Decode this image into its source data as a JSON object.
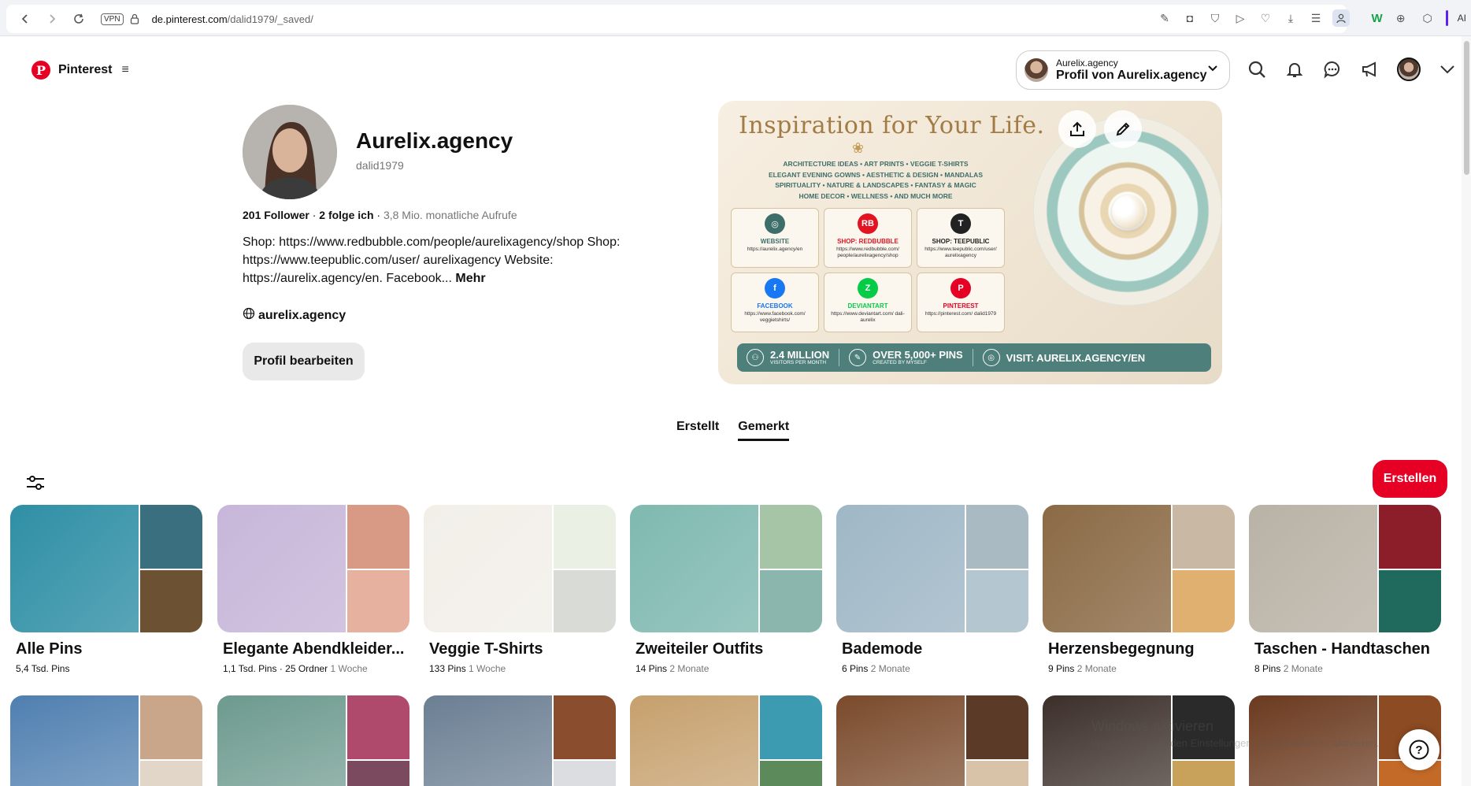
{
  "browser": {
    "url_host": "de.pinterest.com",
    "url_path": "/dalid1979/_saved/",
    "vpn_label": "VPN",
    "ext_w": "W",
    "ext_ai": "AI"
  },
  "header": {
    "logo_text": "Pinterest",
    "account_small": "Aurelix.agency",
    "account_big": "Profil von Aurelix.agency"
  },
  "profile": {
    "name": "Aurelix.agency",
    "handle": "dalid1979",
    "followers": "201 Follower",
    "following": "2 folge ich",
    "monthly_views": "3,8 Mio. monatliche Aufrufe",
    "bio": "Shop: https://www.redbubble.com/people/aurelixagency/shop Shop: https://www.teepublic.com/user/ aurelixagency Website: https://aurelix.agency/en. Facebook...",
    "bio_more": "Mehr",
    "website": "aurelix.agency",
    "edit_button": "Profil bearbeiten"
  },
  "banner": {
    "title": "Inspiration for Your Life.",
    "categories_line1": "ARCHITECTURE IDEAS  •  ART PRINTS  •  VEGGIE T-SHIRTS",
    "categories_line2": "ELEGANT EVENING GOWNS  •  AESTHETIC & DESIGN  •  MANDALAS",
    "categories_line3": "SPIRITUALITY  •  NATURE & LANDSCAPES  •  FANTASY & MAGIC",
    "categories_line4": "HOME DECOR  •  WELLNESS  •  AND MUCH MORE",
    "tiles": [
      {
        "label": "WEBSITE",
        "url": "https://aurelix.agency/en",
        "color": "#3e6e6a",
        "glyph": "◎"
      },
      {
        "label": "SHOP: REDBUBBLE",
        "url": "https://www.redbubble.com/ people/aurelixagency/shop",
        "color": "#e41321",
        "glyph": "RB"
      },
      {
        "label": "SHOP: TEEPUBLIC",
        "url": "https://www.teepublic.com/user/ aurelixagency",
        "color": "#222222",
        "glyph": "T"
      },
      {
        "label": "FACEBOOK",
        "url": "https://www.facebook.com/ veggietshirts/",
        "color": "#1877f2",
        "glyph": "f"
      },
      {
        "label": "DEVIANTART",
        "url": "https://www.deviantart.com/ dali-aurelix",
        "color": "#05cc47",
        "glyph": "Z"
      },
      {
        "label": "PINTEREST",
        "url": "https://pinterest.com/ dalid1979",
        "color": "#e60023",
        "glyph": "P"
      }
    ],
    "stat1_big": "2.4 MILLION",
    "stat1_small": "VISITORS PER MONTH",
    "stat2_big": "OVER 5,000+ PINS",
    "stat2_small": "CREATED BY MYSELF",
    "stat3_big": "VISIT: AURELIX.AGENCY/EN"
  },
  "tabs": {
    "created": "Erstellt",
    "saved": "Gemerkt"
  },
  "actions": {
    "create": "Erstellen"
  },
  "boards": [
    {
      "title": "Alle Pins",
      "pins": "5,4 Tsd. Pins",
      "extra": "",
      "time": "",
      "c1": "#2f8fa5",
      "c2": "#3a6f80",
      "c3": "#6c5233"
    },
    {
      "title": "Elegante Abendkleider...",
      "pins": "1,1 Tsd. Pins",
      "extra": " · 25 Ordner",
      "time": "1 Woche",
      "c1": "#c7b6d9",
      "c2": "#d89a84",
      "c3": "#e7b1a0"
    },
    {
      "title": "Veggie T-Shirts",
      "pins": "133 Pins",
      "extra": "",
      "time": "1 Woche",
      "c1": "#f2efe9",
      "c2": "#eaf0e4",
      "c3": "#d9dcd6"
    },
    {
      "title": "Zweiteiler Outfits",
      "pins": "14 Pins",
      "extra": "",
      "time": "2 Monate",
      "c1": "#7fb9b0",
      "c2": "#a6c4a6",
      "c3": "#8ab6ad"
    },
    {
      "title": "Bademode",
      "pins": "6 Pins",
      "extra": "",
      "time": "2 Monate",
      "c1": "#9fb7c6",
      "c2": "#a9bac3",
      "c3": "#b4c6cf"
    },
    {
      "title": "Herzensbegegnung",
      "pins": "9 Pins",
      "extra": "",
      "time": "2 Monate",
      "c1": "#8b6a45",
      "c2": "#c9b8a3",
      "c3": "#e0b070"
    },
    {
      "title": "Taschen - Handtaschen",
      "pins": "8 Pins",
      "extra": "",
      "time": "2 Monate",
      "c1": "#b9b2a6",
      "c2": "#8c1e2a",
      "c3": "#1f6a5c"
    }
  ],
  "boards_row2": [
    {
      "c1": "#4f7fb0",
      "c2": "#c9a58a",
      "c3": "#e2d6c8"
    },
    {
      "c1": "#6d9a8e",
      "c2": "#b04a6c",
      "c3": "#7b4a5e"
    },
    {
      "c1": "#6b7f93",
      "c2": "#8a4d2e",
      "c3": "#dcdde0"
    },
    {
      "c1": "#c6a06d",
      "c2": "#3c9bb0",
      "c3": "#5c8a5a"
    },
    {
      "c1": "#7a4a2b",
      "c2": "#5c3a28",
      "c3": "#d9c3a8"
    },
    {
      "c1": "#3c2f2a",
      "c2": "#2a2a2a",
      "c3": "#c8a15a"
    },
    {
      "c1": "#6b3a1f",
      "c2": "#8c4b22",
      "c3": "#c46a28"
    }
  ],
  "watermark": {
    "title": "Windows aktivieren",
    "sub": "Wechseln Sie zu den Einstellungen, um Windows zu aktivieren."
  },
  "help": "?"
}
